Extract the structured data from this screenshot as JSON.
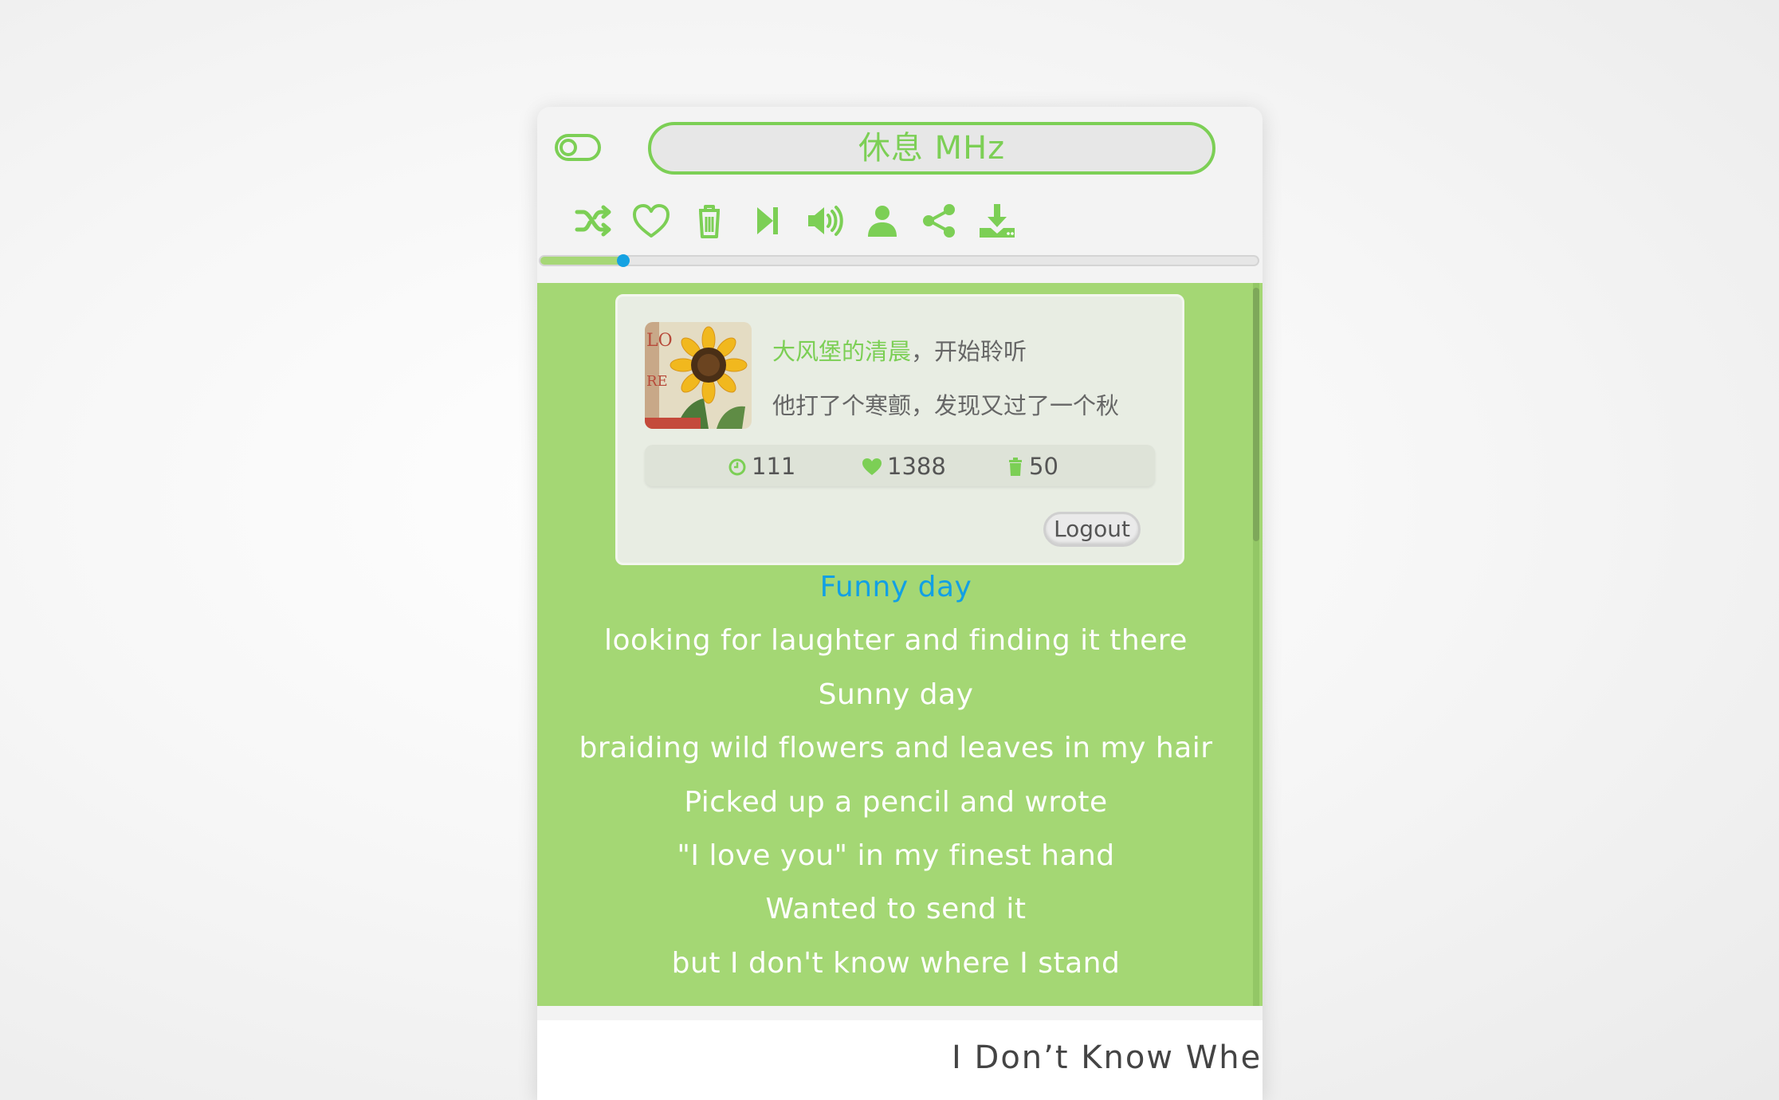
{
  "header": {
    "channel_name": "休息 MHz"
  },
  "toolbar": {
    "icons": [
      "shuffle-icon",
      "heart-icon",
      "trash-icon",
      "skip-next-icon",
      "volume-icon",
      "user-icon",
      "share-icon",
      "download-icon"
    ]
  },
  "progress": {
    "value": 0.115
  },
  "user": {
    "name": "大风堡的清晨",
    "greeting_suffix": "，开始聆听",
    "quote": "他打了个寒颤，发现又过了一个秋",
    "stats": {
      "played": "111",
      "liked": "1388",
      "trashed": "50"
    },
    "logout_label": "Logout"
  },
  "lyrics": {
    "lines": [
      "Funny day",
      "looking for laughter and finding it there",
      "Sunny day",
      "braiding wild flowers and leaves in my hair",
      "Picked up a pencil and wrote",
      "\"I love you\" in my finest hand",
      "Wanted to send it",
      "but I don't know where I stand"
    ],
    "current_index": 0
  },
  "song": {
    "title": "I Don’t Know Whe"
  },
  "colors": {
    "accent": "#7ccf55",
    "panel": "#a4d774",
    "highlight": "#12a0e4"
  }
}
